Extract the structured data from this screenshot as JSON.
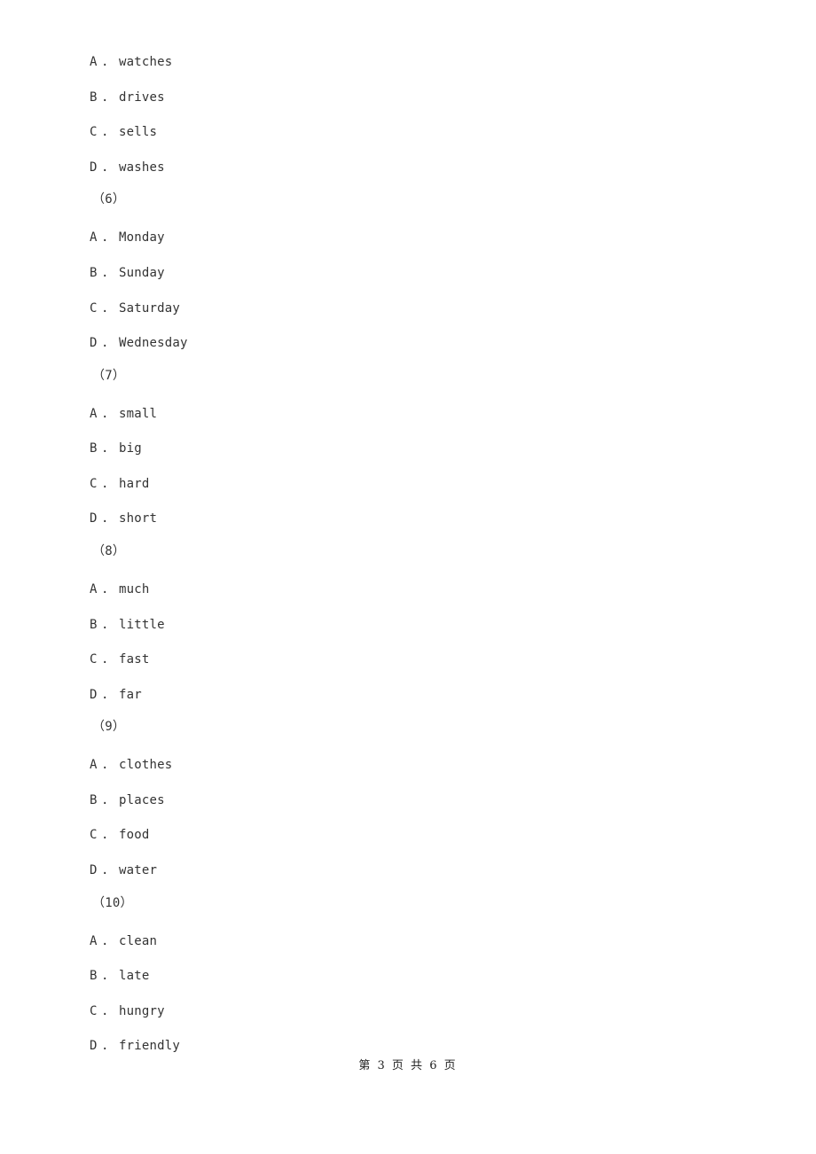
{
  "document": {
    "blocks": [
      {
        "type": "option",
        "letter": "A",
        "text": "watches"
      },
      {
        "type": "option",
        "letter": "B",
        "text": "drives"
      },
      {
        "type": "option",
        "letter": "C",
        "text": "sells"
      },
      {
        "type": "option",
        "letter": "D",
        "text": "washes"
      },
      {
        "type": "question",
        "label": "（6）"
      },
      {
        "type": "option",
        "letter": "A",
        "text": "Monday"
      },
      {
        "type": "option",
        "letter": "B",
        "text": "Sunday"
      },
      {
        "type": "option",
        "letter": "C",
        "text": "Saturday"
      },
      {
        "type": "option",
        "letter": "D",
        "text": "Wednesday"
      },
      {
        "type": "question",
        "label": "（7）"
      },
      {
        "type": "option",
        "letter": "A",
        "text": "small"
      },
      {
        "type": "option",
        "letter": "B",
        "text": "big"
      },
      {
        "type": "option",
        "letter": "C",
        "text": "hard"
      },
      {
        "type": "option",
        "letter": "D",
        "text": "short"
      },
      {
        "type": "question",
        "label": "（8）"
      },
      {
        "type": "option",
        "letter": "A",
        "text": "much"
      },
      {
        "type": "option",
        "letter": "B",
        "text": "little"
      },
      {
        "type": "option",
        "letter": "C",
        "text": "fast"
      },
      {
        "type": "option",
        "letter": "D",
        "text": "far"
      },
      {
        "type": "question",
        "label": "（9）"
      },
      {
        "type": "option",
        "letter": "A",
        "text": "clothes"
      },
      {
        "type": "option",
        "letter": "B",
        "text": "places"
      },
      {
        "type": "option",
        "letter": "C",
        "text": "food"
      },
      {
        "type": "option",
        "letter": "D",
        "text": "water"
      },
      {
        "type": "question",
        "label": "（10）"
      },
      {
        "type": "option",
        "letter": "A",
        "text": "clean"
      },
      {
        "type": "option",
        "letter": "B",
        "text": "late"
      },
      {
        "type": "option",
        "letter": "C",
        "text": "hungry"
      },
      {
        "type": "option",
        "letter": "D",
        "text": "friendly"
      }
    ],
    "option_separator": ".",
    "footer": "第 3 页 共 6 页"
  }
}
